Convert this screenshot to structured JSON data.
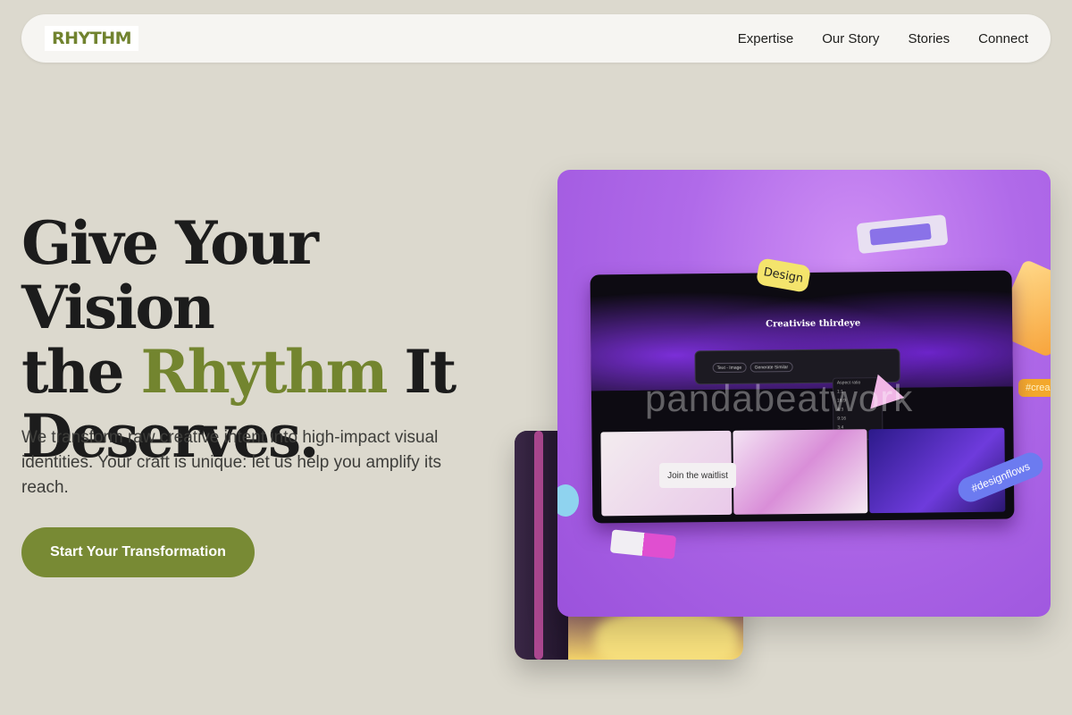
{
  "nav": {
    "logo": "RHYTHM",
    "links": [
      "Expertise",
      "Our Story",
      "Stories",
      "Connect"
    ]
  },
  "hero": {
    "headline_line1": "Give Your Vision",
    "headline_line2_pre": "the ",
    "headline_accent": "Rhythm",
    "headline_line2_post": " It",
    "headline_line3": "Deserves.",
    "subtext": "We transform raw creative intent into high-impact visual identities. Your craft is unique: let us help you amplify its reach.",
    "cta_label": "Start Your Transformation"
  },
  "showcase": {
    "brand_text": "Creativise thirdeye",
    "tag_design": "Design",
    "tag_flows": "#designflows",
    "waitlist_label": "Join the waitlist",
    "watermark": "pandabeatwork",
    "chip_label": "#crea",
    "prompt_pill1": "Text - Image",
    "prompt_pill2": "Generate Similar",
    "aspect_title": "Aspect ratio",
    "aspect_options": [
      "1:1",
      "16:9",
      "4:3",
      "9:16",
      "3:4"
    ]
  },
  "colors": {
    "background": "#dcd9ce",
    "accent": "#788a34",
    "nav_bg": "#f6f5f2"
  }
}
